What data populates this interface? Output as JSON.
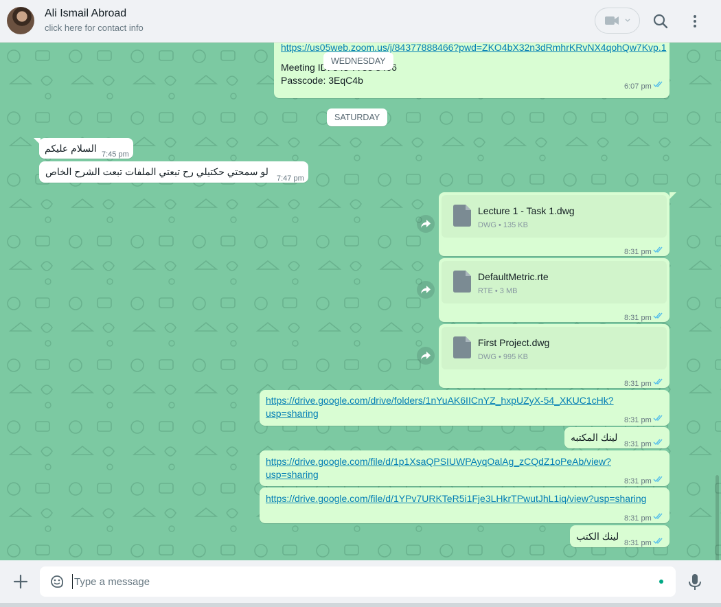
{
  "header": {
    "contact_name": "Ali Ismail Abroad",
    "contact_subtitle": "click here for contact info"
  },
  "chips": {
    "wednesday": "WEDNESDAY",
    "saturday": "SATURDAY"
  },
  "messages": {
    "zoom": {
      "link": "https://us05web.zoom.us/j/84377888466?pwd=ZKO4bX32n3dRmhrKRvNX4qohQw7Kvp.1",
      "meeting_id": "Meeting ID: 843 7788 8466",
      "passcode": "Passcode: 3EqC4b",
      "time": "6:07 pm"
    },
    "salam": {
      "text": "السلام عليكم",
      "time": "7:45 pm"
    },
    "request": {
      "text": "لو سمحتي حكتيلي رح تبعتي الملفات تبعت الشرح الخاص",
      "time": "7:47 pm"
    },
    "file1": {
      "name": "Lecture 1 - Task 1.dwg",
      "meta": "DWG • 135 kB",
      "time": "8:31 pm"
    },
    "file2": {
      "name": "DefaultMetric.rte",
      "meta": "RTE • 3 MB",
      "time": "8:31 pm"
    },
    "file3": {
      "name": "First Project.dwg",
      "meta": "DWG • 995 kB",
      "time": "8:31 pm"
    },
    "link1": {
      "line1": "https://drive.google.com/drive/folders/1nYuAK6IICnYZ_hxpUZyX-54_XKUC1cHk?",
      "line2": "usp=sharing",
      "time": "8:31 pm"
    },
    "library": {
      "text": "لينك المكتبه",
      "time": "8:31 pm"
    },
    "link2": {
      "line1": "https://drive.google.com/file/d/1p1XsaQPSIUWPAyqOalAg_zCQdZ1oPeAb/view?",
      "line2": "usp=sharing",
      "time": "8:31 pm"
    },
    "link3": {
      "text": "https://drive.google.com/file/d/1YPv7URKTeR5i1Fje3LHkrTPwutJhL1iq/view?usp=sharing",
      "time": "8:31 pm"
    },
    "books": {
      "text": "لينك الكتب",
      "time": "8:31 pm"
    }
  },
  "composer": {
    "placeholder": "Type a message"
  },
  "colors": {
    "chat_bg": "#7cc9a2",
    "outgoing_bubble": "#d9fdd3",
    "incoming_bubble": "#ffffff",
    "link": "#027eb5",
    "read_tick": "#53bdeb"
  },
  "icons": [
    "video-camera-icon",
    "chevron-down-icon",
    "search-icon",
    "menu-dots-icon",
    "file-icon",
    "forward-icon",
    "read-tick-icon",
    "plus-icon",
    "sticker-icon",
    "mic-icon"
  ]
}
